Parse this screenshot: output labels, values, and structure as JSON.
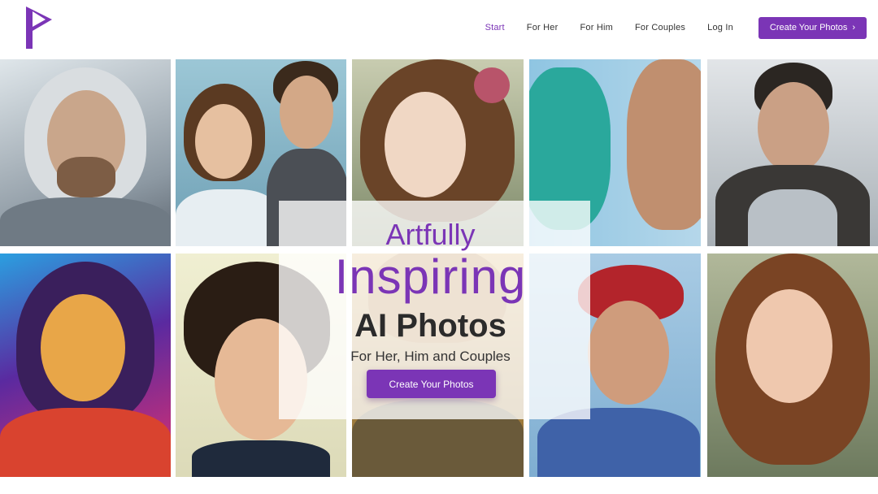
{
  "nav": {
    "items": [
      {
        "label": "Start",
        "active": true
      },
      {
        "label": "For Her",
        "active": false
      },
      {
        "label": "For Him",
        "active": false
      },
      {
        "label": "For Couples",
        "active": false
      },
      {
        "label": "Log In",
        "active": false
      }
    ],
    "cta_label": "Create Your Photos",
    "cta_icon": "chevron-right-icon"
  },
  "hero": {
    "line1": "Artfully",
    "line2": "Inspiring",
    "line3": "AI Photos",
    "subtitle": "For Her, Him and Couples",
    "button_label": "Create Your Photos"
  },
  "colors": {
    "brand": "#7b35b6",
    "text_dark": "#2b2b2b"
  },
  "gallery": {
    "tiles": [
      {
        "name": "portrait-silver-knight",
        "bg": "#c9d2d9"
      },
      {
        "name": "portrait-couple-formal",
        "bg": "#8fb3c2"
      },
      {
        "name": "portrait-woman-floral-hair",
        "bg": "#b9c2a6"
      },
      {
        "name": "portrait-couple-mosaic",
        "bg": "#a8cbe0"
      },
      {
        "name": "portrait-armored-hero",
        "bg": "#cfd4d8"
      },
      {
        "name": "portrait-neon-warrior-woman",
        "bg": "#3b2a7a"
      },
      {
        "name": "portrait-curly-hair-man",
        "bg": "#e8e6c8"
      },
      {
        "name": "portrait-golden-feathers",
        "bg": "#c89a4a"
      },
      {
        "name": "portrait-baseball-player",
        "bg": "#9fc3de"
      },
      {
        "name": "portrait-elf-woman",
        "bg": "#9aa88a"
      }
    ]
  }
}
